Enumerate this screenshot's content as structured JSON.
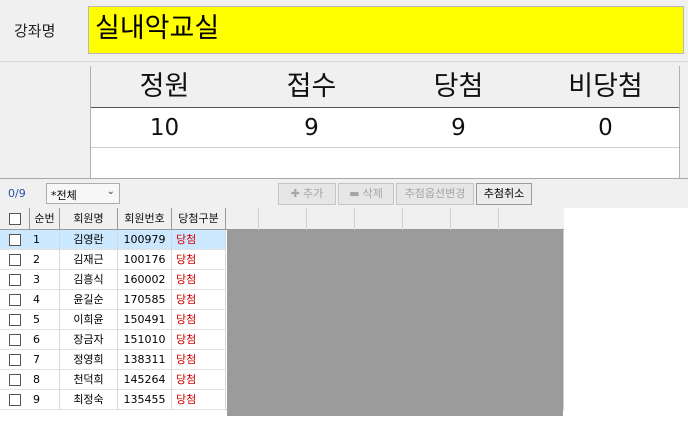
{
  "course": {
    "label": "강좌명",
    "name": "실내악교실"
  },
  "stats": {
    "headers": [
      "정원",
      "접수",
      "당첨",
      "비당첨"
    ],
    "values": [
      "10",
      "9",
      "9",
      "0"
    ]
  },
  "toolbar": {
    "count": "0/9",
    "filter": "*전체",
    "add": "추가",
    "delete": "삭제",
    "lottery_options": "추첨옵션변경",
    "cancel_lottery": "추첨취소"
  },
  "grid": {
    "headers": {
      "seq": "순번",
      "name": "회원명",
      "member_no": "회원번호",
      "win_type": "당첨구분"
    },
    "rows": [
      {
        "seq": "1",
        "name": "김영란",
        "member_no": "100979",
        "win_type": "당첨"
      },
      {
        "seq": "2",
        "name": "김재근",
        "member_no": "100176",
        "win_type": "당첨"
      },
      {
        "seq": "3",
        "name": "김흥식",
        "member_no": "160002",
        "win_type": "당첨"
      },
      {
        "seq": "4",
        "name": "윤길순",
        "member_no": "170585",
        "win_type": "당첨"
      },
      {
        "seq": "5",
        "name": "이희윤",
        "member_no": "150491",
        "win_type": "당첨"
      },
      {
        "seq": "6",
        "name": "장금자",
        "member_no": "151010",
        "win_type": "당첨"
      },
      {
        "seq": "7",
        "name": "정영희",
        "member_no": "138311",
        "win_type": "당첨"
      },
      {
        "seq": "8",
        "name": "천덕희",
        "member_no": "145264",
        "win_type": "당첨"
      },
      {
        "seq": "9",
        "name": "최정숙",
        "member_no": "135455",
        "win_type": "당첨"
      }
    ]
  },
  "colors": {
    "highlight": "#ffff00",
    "selected_row": "#cce8ff",
    "win_text": "#d40000",
    "count_text": "#2a50a8"
  }
}
